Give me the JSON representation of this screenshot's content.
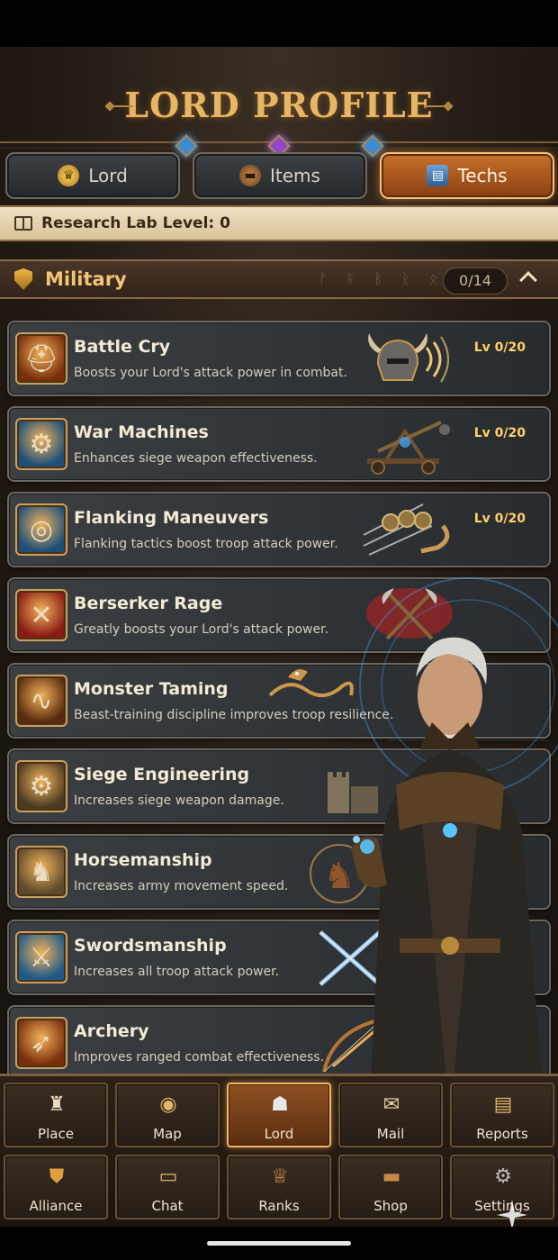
{
  "header": {
    "title": "LORD PROFILE"
  },
  "tabs": [
    {
      "label": "Lord",
      "icon": "crown-icon",
      "active": false
    },
    {
      "label": "Items",
      "icon": "chest-icon",
      "active": false
    },
    {
      "label": "Techs",
      "icon": "book-icon",
      "active": true
    }
  ],
  "research_lab": {
    "label": "Research Lab Level: 0"
  },
  "section": {
    "title": "Military",
    "runes": "ᚠ ᚱ ᛒ ᚱ ᛟ ᚾ",
    "progress": "0/14",
    "expanded": true
  },
  "techs": [
    {
      "name": "Battle Cry",
      "desc": "Boosts your Lord's attack power in combat.",
      "level": "Lv 0/20",
      "icon": "viking-helmet-icon",
      "icon_bg": "#7a2e0c"
    },
    {
      "name": "War Machines",
      "desc": "Enhances siege weapon effectiveness.",
      "level": "Lv 0/20",
      "icon": "catapult-icon",
      "icon_bg": "#1d4f7a"
    },
    {
      "name": "Flanking Maneuvers",
      "desc": "Flanking tactics boost troop attack power.",
      "level": "Lv 0/20",
      "icon": "shields-arrows-icon",
      "icon_bg": "#1d4f7a"
    },
    {
      "name": "Berserker Rage",
      "desc": "Greatly boosts your Lord's attack power.",
      "level": "",
      "icon": "crossed-axes-icon",
      "icon_bg": "#8a1a14"
    },
    {
      "name": "Monster Taming",
      "desc": "Beast-training discipline improves troop resilience.",
      "level": "",
      "icon": "dragon-icon",
      "icon_bg": "#5a2a0e"
    },
    {
      "name": "Siege Engineering",
      "desc": "Increases siege weapon damage.",
      "level": "",
      "icon": "gears-icon",
      "icon_bg": "#4a3a22"
    },
    {
      "name": "Horsemanship",
      "desc": "Increases army movement speed.",
      "level": "",
      "icon": "horse-icon",
      "icon_bg": "#5e4a2c"
    },
    {
      "name": "Swordsmanship",
      "desc": "Increases all troop attack power.",
      "level": "",
      "icon": "crossed-swords-icon",
      "icon_bg": "#1d5a8a"
    },
    {
      "name": "Archery",
      "desc": "Improves ranged combat effectiveness.",
      "level": "",
      "icon": "bow-arrow-icon",
      "icon_bg": "#7a2e0c"
    }
  ],
  "nav_row1": [
    {
      "label": "Place",
      "icon": "castle-icon"
    },
    {
      "label": "Map",
      "icon": "globe-icon"
    },
    {
      "label": "Lord",
      "icon": "knight-helmet-icon",
      "active": true
    },
    {
      "label": "Mail",
      "icon": "scroll-icon"
    },
    {
      "label": "Reports",
      "icon": "report-icon"
    }
  ],
  "nav_row2": [
    {
      "label": "Alliance",
      "icon": "alliance-icon"
    },
    {
      "label": "Chat",
      "icon": "chat-icon"
    },
    {
      "label": "Ranks",
      "icon": "trophy-icon"
    },
    {
      "label": "Shop",
      "icon": "chest-icon"
    },
    {
      "label": "Settings",
      "icon": "gear-icon"
    }
  ],
  "colors": {
    "accent": "#e7b664",
    "active_tab": "#c8702b",
    "level_text": "#ffd06a"
  }
}
